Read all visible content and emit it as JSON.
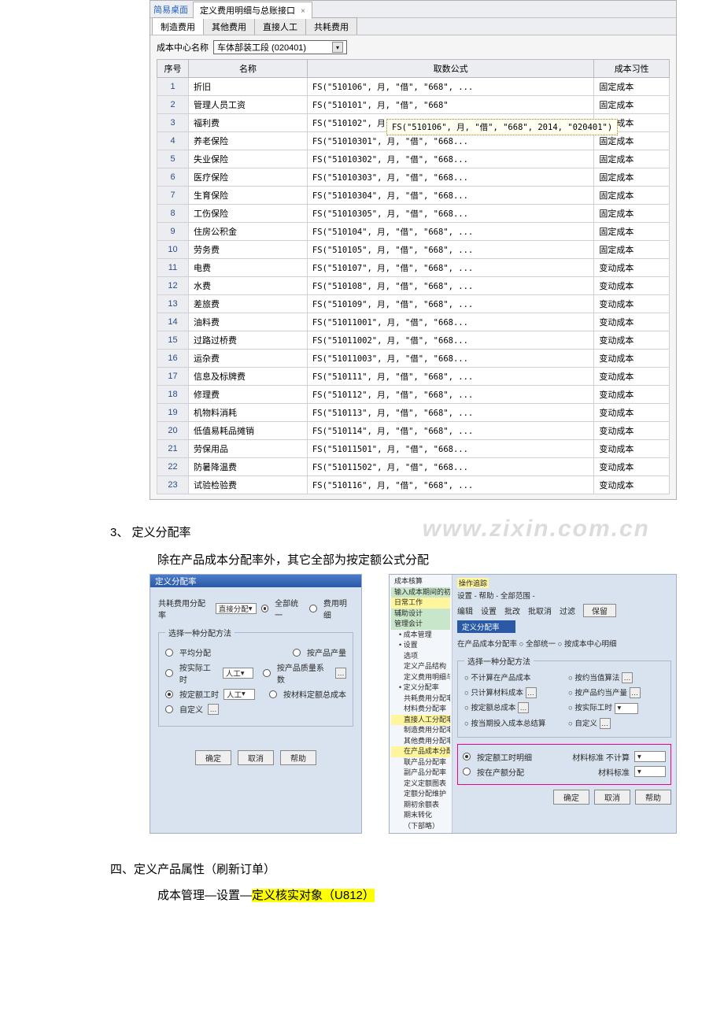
{
  "shot1": {
    "breadcrumb_link": "简易桌面",
    "active_tab": "定义费用明细与总账接口",
    "subtabs": [
      "制造费用",
      "其他费用",
      "直接人工",
      "共耗费用"
    ],
    "cost_center_label": "成本中心名称",
    "cost_center_value": "车体部装工段  (020401)",
    "columns": [
      "序号",
      "名称",
      "取数公式",
      "成本习性"
    ],
    "tooltip": "FS(\"510106\", 月, \"借\", \"668\", 2014, \"020401\")",
    "rows": [
      {
        "seq": "1",
        "name": "折旧",
        "formula": "FS(\"510106\", 月, \"借\", \"668\", ...",
        "type": "固定成本"
      },
      {
        "seq": "2",
        "name": "管理人员工资",
        "formula": "FS(\"510101\", 月, \"借\", \"668\"",
        "type": "固定成本"
      },
      {
        "seq": "3",
        "name": "福利费",
        "formula": "FS(\"510102\", 月, \"借\", \"668\", ...",
        "type": "固定成本"
      },
      {
        "seq": "4",
        "name": "养老保险",
        "formula": "FS(\"51010301\", 月, \"借\", \"668...",
        "type": "固定成本"
      },
      {
        "seq": "5",
        "name": "失业保险",
        "formula": "FS(\"51010302\", 月, \"借\", \"668...",
        "type": "固定成本"
      },
      {
        "seq": "6",
        "name": "医疗保险",
        "formula": "FS(\"51010303\", 月, \"借\", \"668...",
        "type": "固定成本"
      },
      {
        "seq": "7",
        "name": "生育保险",
        "formula": "FS(\"51010304\", 月, \"借\", \"668...",
        "type": "固定成本"
      },
      {
        "seq": "8",
        "name": "工伤保险",
        "formula": "FS(\"51010305\", 月, \"借\", \"668...",
        "type": "固定成本"
      },
      {
        "seq": "9",
        "name": "住房公积金",
        "formula": "FS(\"510104\", 月, \"借\", \"668\", ...",
        "type": "固定成本"
      },
      {
        "seq": "10",
        "name": "劳务费",
        "formula": "FS(\"510105\", 月, \"借\", \"668\", ...",
        "type": "固定成本"
      },
      {
        "seq": "11",
        "name": "电费",
        "formula": "FS(\"510107\", 月, \"借\", \"668\", ...",
        "type": "变动成本"
      },
      {
        "seq": "12",
        "name": "水费",
        "formula": "FS(\"510108\", 月, \"借\", \"668\", ...",
        "type": "变动成本"
      },
      {
        "seq": "13",
        "name": "差旅费",
        "formula": "FS(\"510109\", 月, \"借\", \"668\", ...",
        "type": "变动成本"
      },
      {
        "seq": "14",
        "name": "油料费",
        "formula": "FS(\"51011001\", 月, \"借\", \"668...",
        "type": "变动成本"
      },
      {
        "seq": "15",
        "name": "过路过桥费",
        "formula": "FS(\"51011002\", 月, \"借\", \"668...",
        "type": "变动成本"
      },
      {
        "seq": "16",
        "name": "运杂费",
        "formula": "FS(\"51011003\", 月, \"借\", \"668...",
        "type": "变动成本"
      },
      {
        "seq": "17",
        "name": "信息及标牌费",
        "formula": "FS(\"510111\", 月, \"借\", \"668\", ...",
        "type": "变动成本"
      },
      {
        "seq": "18",
        "name": "修理费",
        "formula": "FS(\"510112\", 月, \"借\", \"668\", ...",
        "type": "变动成本"
      },
      {
        "seq": "19",
        "name": "机物料消耗",
        "formula": "FS(\"510113\", 月, \"借\", \"668\", ...",
        "type": "变动成本"
      },
      {
        "seq": "20",
        "name": "低值易耗品摊销",
        "formula": "FS(\"510114\", 月, \"借\", \"668\", ...",
        "type": "变动成本"
      },
      {
        "seq": "21",
        "name": "劳保用品",
        "formula": "FS(\"51011501\", 月, \"借\", \"668...",
        "type": "变动成本"
      },
      {
        "seq": "22",
        "name": "防暑降温费",
        "formula": "FS(\"51011502\", 月, \"借\", \"668...",
        "type": "变动成本"
      },
      {
        "seq": "23",
        "name": "试验检验费",
        "formula": "FS(\"510116\", 月, \"借\", \"668\", ...",
        "type": "变动成本"
      }
    ]
  },
  "sec3": {
    "title": "3、 定义分配率",
    "sub": "除在产品成本分配率外，其它全部为按定额公式分配",
    "watermark": "www.zixin.com.cn"
  },
  "shot2": {
    "title": "定义分配率",
    "row1_label": "共耗费用分配率",
    "row1_select": "直接分配",
    "row1_opt1": "全部统一",
    "row1_opt2": "费用明细",
    "legend": "选择一种分配方法",
    "methods": {
      "avg": "平均分配",
      "byprod": "按产品产量",
      "actual_hr": "按实际工时",
      "hr_val": "人工",
      "qual": "按产品质量系数",
      "fixed_hr": "按定额工时",
      "hr_val2": "人工",
      "byfixed": "按材料定额总成本",
      "custom": "自定义"
    },
    "buttons": {
      "ok": "确定",
      "cancel": "取消",
      "help": "帮助"
    }
  },
  "shot3": {
    "tabstrip": "操作追踪",
    "tree": [
      {
        "t": "成本核算",
        "l": 1
      },
      {
        "t": "输入成本期间的初始",
        "l": 1,
        "cls": "hl-green"
      },
      {
        "t": "日常工作",
        "l": 1,
        "cls": "hl-yellow"
      },
      {
        "t": "辅助设计",
        "l": 1,
        "cls": "hl-green"
      },
      {
        "t": "管理会计",
        "l": 1,
        "cls": "hl-green"
      },
      {
        "t": "• 成本管理",
        "l": 2
      },
      {
        "t": "• 设置",
        "l": 2
      },
      {
        "t": "选项",
        "l": 3
      },
      {
        "t": "定义产品结构",
        "l": 3
      },
      {
        "t": "定义费用明细与接口",
        "l": 3
      },
      {
        "t": "• 定义分配率",
        "l": 2
      },
      {
        "t": "共耗费用分配率",
        "l": 3
      },
      {
        "t": "材料费分配率",
        "l": 3
      },
      {
        "t": "直接人工分配率",
        "l": 3,
        "cls": "hl-yellow"
      },
      {
        "t": "制造费用分配率",
        "l": 3
      },
      {
        "t": "其他费用分配率",
        "l": 3
      },
      {
        "t": "在产品成本分配",
        "l": 3,
        "cls": "hl-yellow"
      },
      {
        "t": "联产品分配率",
        "l": 3
      },
      {
        "t": "副产品分配率",
        "l": 3
      },
      {
        "t": "定义定额图表",
        "l": 3
      },
      {
        "t": "定额分配维护",
        "l": 3
      },
      {
        "t": "期初余额表",
        "l": 3
      },
      {
        "t": "期末转化",
        "l": 3
      },
      {
        "t": "（下部略）",
        "l": 3
      }
    ],
    "crumb": "设置 - 帮助 - 全部范围 -",
    "toolbar": {
      "l1": "编辑",
      "l2": "设置",
      "l3": "批改",
      "l4": "批取消",
      "l5": "过滤",
      "l6": "保留"
    },
    "select_badge": "定义分配率",
    "heading": "在产品成本分配率  ○ 全部统一  ○ 按成本中心明细",
    "legend": "选择一种分配方法",
    "opts": {
      "a": "不计算在产品成本",
      "b": "按约当值算法",
      "c": "只计算材料成本",
      "d": "按产品约当产量",
      "e": "按定额总成本",
      "f": "按实际工时",
      "g": "按当期投入成本总结算",
      "h": "自定义"
    },
    "box_legend1": "按定额工时明细",
    "box_label1": "材料标准  不计算",
    "box_legend2": "按在产额分配",
    "box_label2": "材料标准",
    "footer": {
      "ok": "确定",
      "cancel": "取消",
      "help": "帮助"
    }
  },
  "final": {
    "line1": "四、定义产品属性（刷新订单）",
    "line2a": "成本管理—设置—",
    "line2b": "定义核实对象（U812）"
  }
}
